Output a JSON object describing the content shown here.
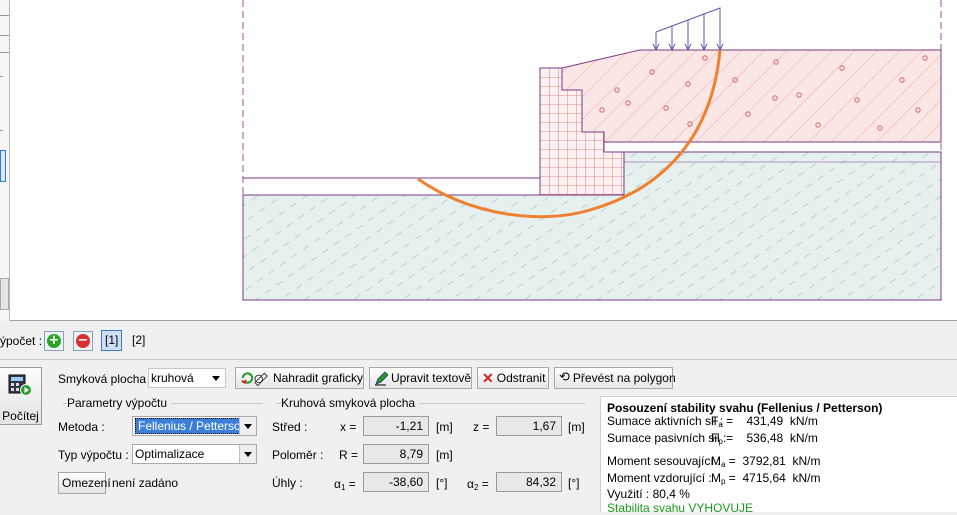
{
  "stage": {
    "label": "ýpočet :",
    "add_symbol": "+",
    "remove_symbol": "−",
    "tabs": [
      "[1]",
      "[2]"
    ]
  },
  "calc_button": {
    "label": "Počítej",
    "icon": "calculator-run-icon"
  },
  "toolbar": {
    "slip_surface_label": "Smyková plocha :",
    "slip_surface_value": "kruhová",
    "replace_graphically": "Nahradit graficky",
    "edit_text": "Upravit textově",
    "remove": "Odstranit",
    "convert_polygon": "Převést na polygon"
  },
  "params": {
    "group_title": "Parametry výpočtu",
    "method_label": "Metoda :",
    "method_value": "Fellenius / Petterson",
    "calc_type_label": "Typ výpočtu :",
    "calc_type_value": "Optimalizace",
    "limits_button": "Omezení",
    "limits_value": "není zadáno"
  },
  "circle": {
    "group_title": "Kruhová smyková plocha",
    "center_label": "Střed :",
    "x_label": "x =",
    "x_value": "-1,21",
    "x_unit": "[m]",
    "z_label": "z =",
    "z_value": "1,67",
    "z_unit": "[m]",
    "radius_label": "Poloměr :",
    "r_label": "R =",
    "r_value": "8,79",
    "r_unit": "[m]",
    "angles_label": "Úhly :",
    "a1_label": "α",
    "a1_sub": "1",
    "a1_eq": "=",
    "a1_value": "-38,60",
    "a1_unit": "[°]",
    "a2_label": "α",
    "a2_sub": "2",
    "a2_eq": "=",
    "a2_value": "84,32",
    "a2_unit": "[°]"
  },
  "results": {
    "title": "Posouzení stability svahu (Fellenius / Petterson)",
    "active_label": "Sumace aktivních sil :",
    "active_sym": "F",
    "active_sub": "a",
    "active_value": "=    431,49  kN/m",
    "passive_label": "Sumace pasivních sil :",
    "passive_sym": "F",
    "passive_sub": "p",
    "passive_value": "=    536,48  kN/m",
    "moment_slide_label": "Moment sesouvající :",
    "moment_slide_sym": "M",
    "moment_slide_sub": "a",
    "moment_slide_value": "=  3792,81  kN/m",
    "moment_resist_label": "Moment vzdorující :",
    "moment_resist_sym": "M",
    "moment_resist_sub": "p",
    "moment_resist_value": "=  4715,64  kN/m",
    "utilization": "Využití : 80,4 %",
    "verdict": "Stabilita svahu VYHOVUJE"
  },
  "colors": {
    "upper_soil_fill": "#fbe6e6",
    "upper_soil_hatch": "#e06060",
    "lower_soil_fill": "#e3efec",
    "lower_soil_hatch": "#7aa89a",
    "boundary": "#7a3a8a",
    "slip_surface": "#f08030",
    "load_arrows": "#5a5aa8",
    "ok_text": "#1a9a1a",
    "selection": "#3c7fd8"
  }
}
